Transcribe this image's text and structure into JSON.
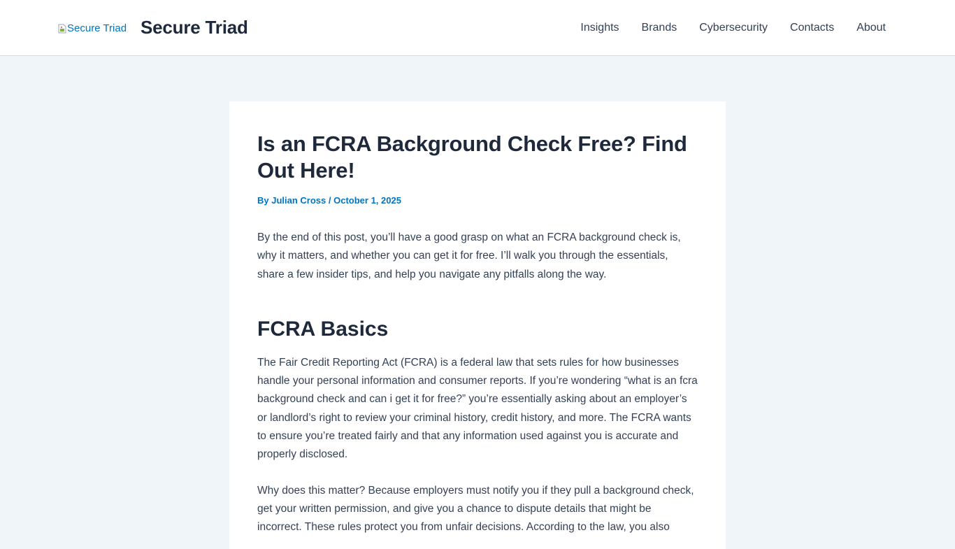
{
  "header": {
    "logo_alt": "Secure Triad",
    "site_title": "Secure Triad",
    "nav": [
      "Insights",
      "Brands",
      "Cybersecurity",
      "Contacts",
      "About"
    ]
  },
  "article": {
    "title": "Is an FCRA Background Check Free? Find Out Here!",
    "meta_prefix": "By ",
    "author": "Julian Cross",
    "separator": " / ",
    "date": "October 1, 2025",
    "intro": "By the end of this post, you’ll have a good grasp on what an FCRA background check is, why it matters, and whether you can get it for free. I’ll walk you through the essentials, share a few insider tips, and help you navigate any pitfalls along the way.",
    "section_heading": "FCRA Basics",
    "para_basics": "The Fair Credit Reporting Act (FCRA) is a federal law that sets rules for how businesses handle your personal information and consumer reports. If you’re wondering “what is an fcra background check and can i get it for free?” you’re essentially asking about an employer’s or landlord’s right to review your criminal history, credit history, and more. The FCRA wants to ensure you’re treated fairly and that any information used against you is accurate and properly disclosed.",
    "para_why": "Why does this matter? Because employers must notify you if they pull a background check, get your written permission, and give you a chance to dispute details that might be incorrect. These rules protect you from unfair decisions. According to the law, you also"
  },
  "colors": {
    "background": "#f0f5fa",
    "link": "#0274be",
    "heading": "#1e293b",
    "body_text": "#334155"
  }
}
